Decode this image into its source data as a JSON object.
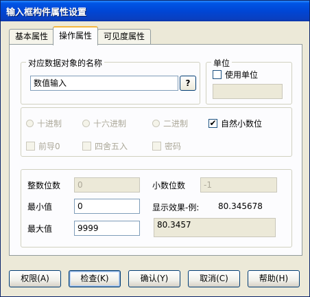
{
  "window": {
    "title": "输入框构件属性设置"
  },
  "tabs": [
    {
      "label": "基本属性"
    },
    {
      "label": "操作属性"
    },
    {
      "label": "可见度属性"
    }
  ],
  "data_object": {
    "legend": "对应数据对象的名称",
    "value": "数值输入",
    "browse_label": "?"
  },
  "unit": {
    "legend": "单位",
    "checkbox_label": "使用单位",
    "checked": false,
    "value": ""
  },
  "format": {
    "radios": [
      {
        "label": "十进制",
        "enabled": false
      },
      {
        "label": "十六进制",
        "enabled": false
      },
      {
        "label": "二进制",
        "enabled": false
      }
    ],
    "natural_decimal": {
      "label": "自然小数位",
      "checked": true,
      "mark": "✔"
    },
    "checks": [
      {
        "label": "前导0",
        "enabled": false
      },
      {
        "label": "四舍五入",
        "enabled": false
      },
      {
        "label": "密码",
        "enabled": false
      }
    ]
  },
  "numeric": {
    "integer_digits_label": "整数位数",
    "integer_digits_value": "0",
    "decimal_digits_label": "小数位数",
    "decimal_digits_value": "-1",
    "min_label": "最小值",
    "min_value": "0",
    "max_label": "最大值",
    "max_value": "9999",
    "preview_label": "显示效果-例:",
    "preview_example": "80.345678",
    "preview_result": "80.3457"
  },
  "buttons": {
    "permission": "权限(A)",
    "check": "检查(K)",
    "confirm": "确认(Y)",
    "cancel": "取消(C)",
    "help": "帮助(H)"
  }
}
